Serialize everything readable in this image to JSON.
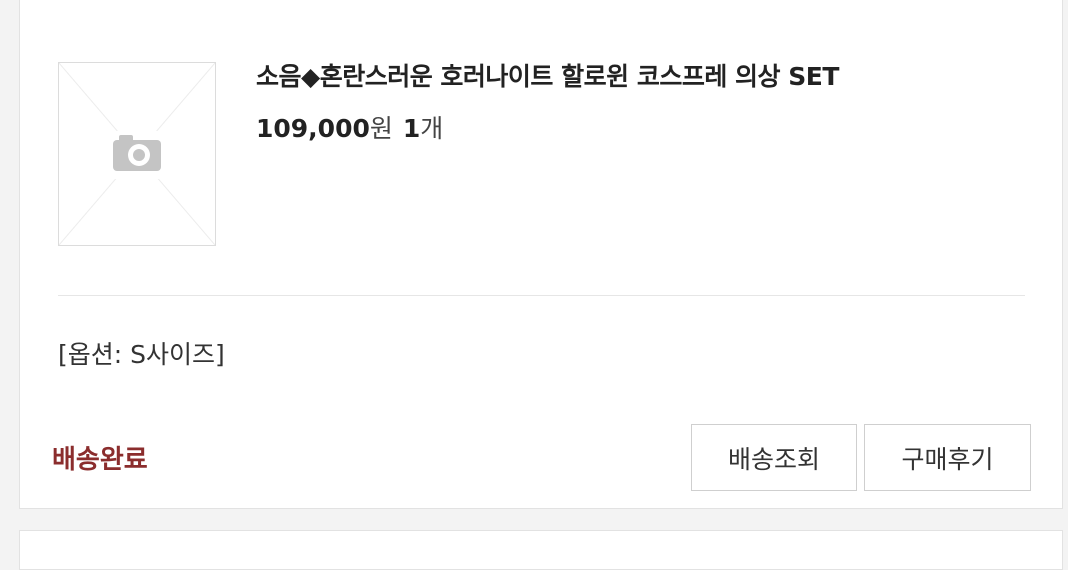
{
  "order": {
    "product_name": "소음◆혼란스러운 호러나이트 할로윈 코스프레 의상 SET",
    "price": "109,000",
    "price_unit": "원",
    "quantity": "1",
    "quantity_unit": "개",
    "option": "[옵션: S사이즈]",
    "status": "배송완료",
    "track_button": "배송조회",
    "review_button": "구매후기",
    "image_placeholder_icon": "camera-icon"
  },
  "colors": {
    "status": "#8b2d2d",
    "background": "#f3f3f3",
    "card": "#ffffff"
  }
}
